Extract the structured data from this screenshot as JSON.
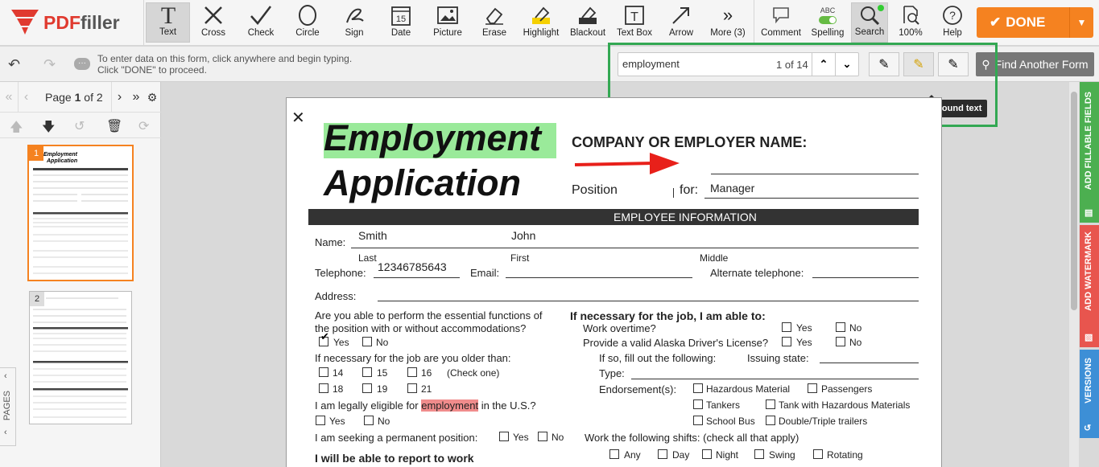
{
  "app": {
    "logo_text_a": "PDF",
    "logo_text_b": "filler"
  },
  "toolbar": {
    "tools": [
      {
        "label": "Text",
        "icon": "text-icon"
      },
      {
        "label": "Cross",
        "icon": "cross-icon"
      },
      {
        "label": "Check",
        "icon": "check-icon"
      },
      {
        "label": "Circle",
        "icon": "circle-icon"
      },
      {
        "label": "Sign",
        "icon": "sign-icon"
      },
      {
        "label": "Date",
        "icon": "date-icon"
      },
      {
        "label": "Picture",
        "icon": "picture-icon"
      },
      {
        "label": "Erase",
        "icon": "erase-icon"
      },
      {
        "label": "Highlight",
        "icon": "highlight-icon"
      },
      {
        "label": "Blackout",
        "icon": "blackout-icon"
      },
      {
        "label": "Text Box",
        "icon": "textbox-icon"
      },
      {
        "label": "Arrow",
        "icon": "arrow-icon"
      },
      {
        "label": "More (3)",
        "icon": "more-icon"
      },
      {
        "label": "Comment",
        "icon": "comment-icon"
      },
      {
        "label": "Spelling",
        "icon": "spelling-icon",
        "badge": "ABC"
      },
      {
        "label": "Search",
        "icon": "search-icon"
      },
      {
        "label": "100%",
        "icon": "zoom-icon"
      },
      {
        "label": "Help",
        "icon": "help-icon"
      }
    ],
    "done_label": "DONE",
    "date_icon_number": "15"
  },
  "subbar": {
    "hint_line1": "To enter data on this form, click anywhere and begin typing.",
    "hint_line2": "Click \"DONE\" to proceed.",
    "search_value": "employment",
    "search_count": "1 of 14",
    "tooltip": "Highlight the found text",
    "find_another": "Find Another Form"
  },
  "pager": {
    "page_word": "Page",
    "current": "1",
    "of_total": "of 2"
  },
  "thumbnails": [
    {
      "num": "1"
    },
    {
      "num": "2"
    }
  ],
  "pages_tab": "PAGES",
  "right_tabs": [
    {
      "label": "ADD FILLABLE FIELDS",
      "color": "#4caf50"
    },
    {
      "label": "ADD WATERMARK",
      "color": "#e8554e"
    },
    {
      "label": "VERSIONS",
      "color": "#3d8fd6"
    }
  ],
  "document": {
    "title1": "Employment",
    "title2": "Application",
    "company_label": "COMPANY OR EMPLOYER NAME:",
    "position_label": "Position",
    "for_label": "for:",
    "position_value": "Manager",
    "section_header": "EMPLOYEE INFORMATION",
    "name_label": "Name:",
    "last_value": "Smith",
    "first_value": "John",
    "last_label": "Last",
    "first_label": "First",
    "middle_label": "Middle",
    "telephone_label": "Telephone:",
    "telephone_value": "12346785643",
    "email_label": "Email:",
    "alt_phone_label": "Alternate telephone:",
    "address_label": "Address:",
    "q_functions_1": "Are you able to perform the essential functions of",
    "q_functions_2": "the position with or without accommodations?",
    "yes": "Yes",
    "no": "No",
    "q_older": "If necessary for the job are you older than:",
    "ages": [
      "14",
      "15",
      "16",
      "18",
      "19",
      "21"
    ],
    "check_one": "(Check one)",
    "q_eligible_a": "I am legally eligible for",
    "q_eligible_hl": "employment",
    "q_eligible_b": "in the U.S.?",
    "q_permanent": "I am seeking a permanent position:",
    "q_report": "I will be able to report to work",
    "r_heading": "If necessary for the job, I am able to:",
    "r_overtime": "Work overtime?",
    "r_license": "Provide a valid Alaska Driver's License?",
    "r_if_so": "If so, fill out the following:",
    "r_issuing": "Issuing state:",
    "r_type": "Type:",
    "r_endorse": "Endorsement(s):",
    "endorsements": [
      "Hazardous Material",
      "Passengers",
      "Tankers",
      "Tank with Hazardous Materials",
      "School Bus",
      "Double/Triple trailers"
    ],
    "r_shifts": "Work the following shifts: (check all that apply)",
    "shifts": [
      "Any",
      "Day",
      "Night",
      "Swing",
      "Rotating"
    ]
  },
  "colors": {
    "accent": "#f58220",
    "search_frame": "#33a853",
    "title_highlight": "#9aea9a",
    "found_highlight": "#f08c8c",
    "arrow": "#e8201a"
  }
}
